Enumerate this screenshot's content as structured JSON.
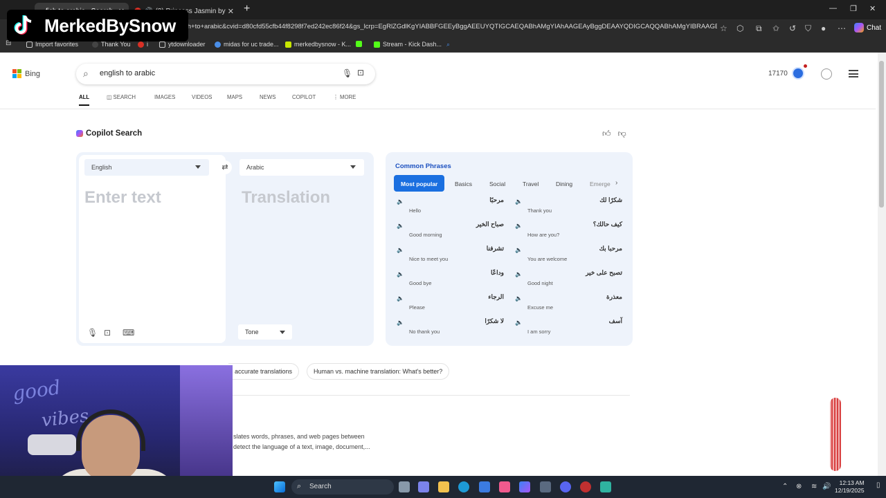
{
  "browser": {
    "tabs": [
      {
        "title": "fish to arabic - Search",
        "close": "✕"
      },
      {
        "title": "(2) Princess Jasmin by",
        "close": "✕"
      }
    ],
    "new_tab": "+",
    "url": "sh+to+arabic&cvid=d80cfd55cfb44f8298f7ed242ec86f24&gs_lcrp=EgRlZGdlKgYIABBFGEEyBggAEEUYQTIGCAEQABhAMgYIAhAAGEAyBggDEAAYQDIGCAQQABhAMgYIBRAAGEAyBgg...",
    "chat_label": "Chat",
    "bookmarks": [
      {
        "label": "Import favorites",
        "color": "#7aa7e8"
      },
      {
        "label": "Thank You",
        "color": "#222222"
      },
      {
        "label": "i",
        "color": "#d93025"
      },
      {
        "label": "ytdownloader",
        "color": "#888888"
      },
      {
        "label": "midas for uc trade...",
        "color": "#4a8ee8"
      },
      {
        "label": "merkedbysnow - K...",
        "color": "#53fc18"
      },
      {
        "label": "",
        "color": "#53fc18"
      },
      {
        "label": "Stream - Kick Dash...",
        "color": "#53fc18"
      }
    ]
  },
  "overlay": {
    "channel_name": "MerkedBySnow"
  },
  "bing": {
    "logo_text": "Bing",
    "query": "english to arabic",
    "points": "17170",
    "nav_tabs": [
      {
        "label": "ALL",
        "active": true
      },
      {
        "label": "SEARCH",
        "active": false
      },
      {
        "label": "IMAGES",
        "active": false
      },
      {
        "label": "VIDEOS",
        "active": false
      },
      {
        "label": "MAPS",
        "active": false
      },
      {
        "label": "NEWS",
        "active": false
      },
      {
        "label": "COPILOT",
        "active": false
      },
      {
        "label": "MORE",
        "active": false
      }
    ]
  },
  "copilot": {
    "title": "Copilot Search",
    "translator": {
      "source_lang": "English",
      "target_lang": "Arabic",
      "input_placeholder": "Enter text",
      "output_placeholder": "Translation",
      "tone_label": "Tone"
    },
    "phrases": {
      "title": "Common Phrases",
      "categories": [
        {
          "label": "Most popular",
          "active": true
        },
        {
          "label": "Basics",
          "active": false
        },
        {
          "label": "Social",
          "active": false
        },
        {
          "label": "Travel",
          "active": false
        },
        {
          "label": "Dining",
          "active": false
        },
        {
          "label": "Emerge",
          "active": false
        }
      ],
      "items": [
        {
          "arabic": "مرحبًا",
          "english": "Hello"
        },
        {
          "arabic": "شكرًا لك",
          "english": "Thank you"
        },
        {
          "arabic": "صباح الخير",
          "english": "Good morning"
        },
        {
          "arabic": "كيف حالك؟",
          "english": "How are you?"
        },
        {
          "arabic": "تشرفنا",
          "english": "Nice to meet you"
        },
        {
          "arabic": "مرحبا بك",
          "english": "You are welcome"
        },
        {
          "arabic": "وداعًا",
          "english": "Good bye"
        },
        {
          "arabic": "تصبح على خير",
          "english": "Good night"
        },
        {
          "arabic": "الرجاء",
          "english": "Please"
        },
        {
          "arabic": "معذرة",
          "english": "Excuse me"
        },
        {
          "arabic": "لا شكرًا",
          "english": "No thank you"
        },
        {
          "arabic": "آسف",
          "english": "I am sorry"
        }
      ]
    }
  },
  "related": {
    "pills": [
      "accurate translations",
      "Human vs. machine translation: What's better?"
    ]
  },
  "snippet": {
    "line1": "slates words, phrases, and web pages between",
    "line2": "detect the language of a text, image, document,..."
  },
  "taskbar": {
    "search_label": "Search",
    "time": "12:13 AM",
    "date": "12/19/2025"
  }
}
